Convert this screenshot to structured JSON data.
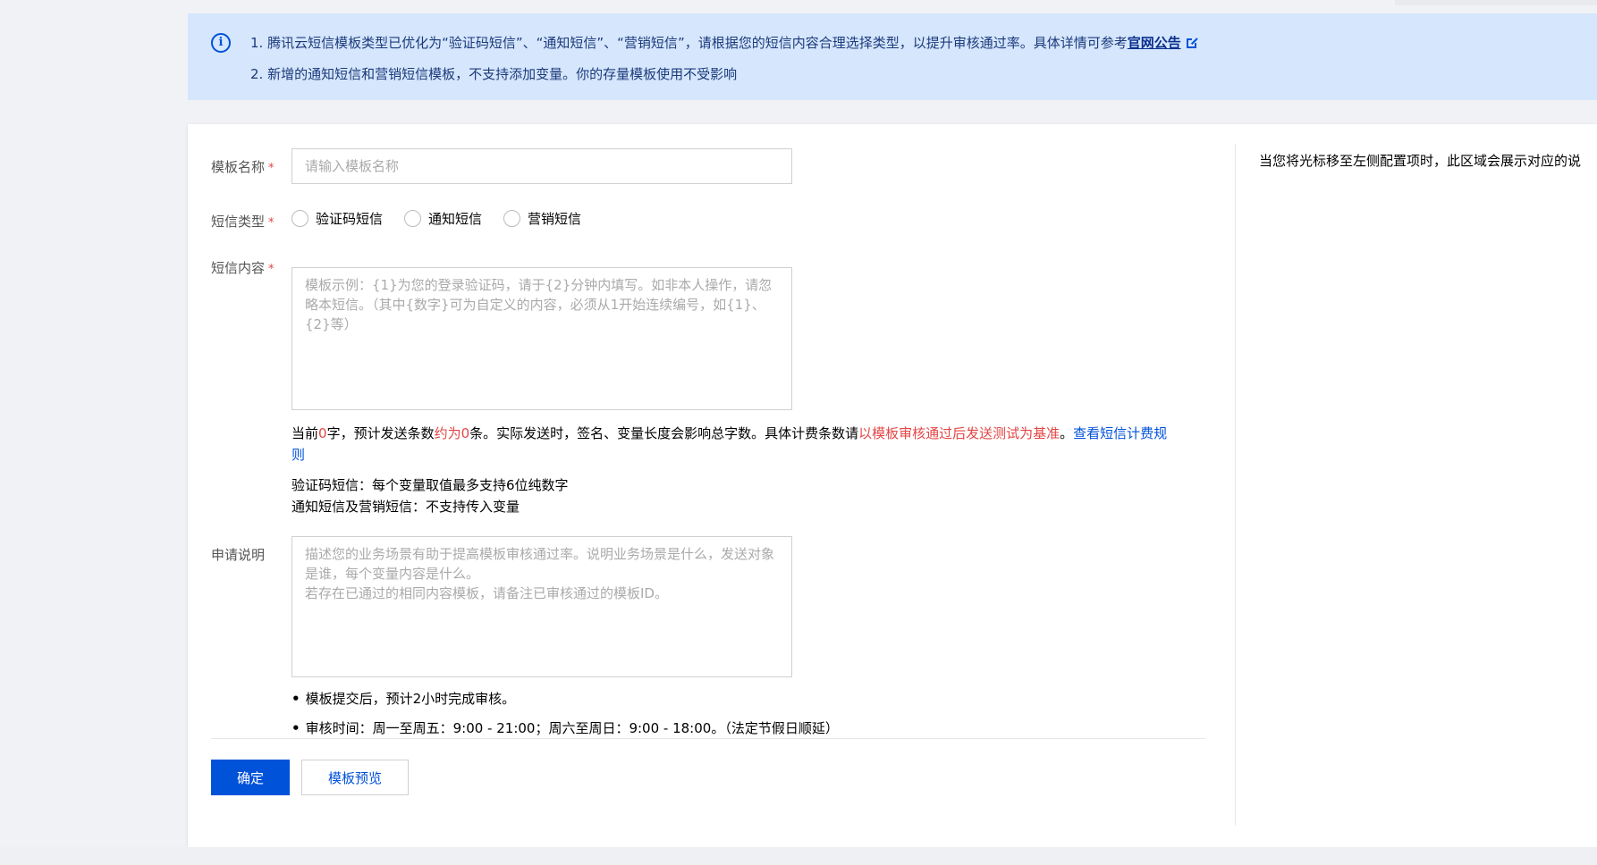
{
  "notice": {
    "icon": "info-circle-icon",
    "line1_text": "1. 腾讯云短信模板类型已优化为“验证码短信”、“通知短信”、“营销短信”，请根据您的短信内容合理选择类型，以提升审核通过率。具体详情可参考",
    "line1_link": "官网公告",
    "line2_text": "2. 新增的通知短信和营销短信模板，不支持添加变量。你的存量模板使用不受影响"
  },
  "form": {
    "name": {
      "label": "模板名称",
      "required": "*",
      "placeholder": "请输入模板名称"
    },
    "type": {
      "label": "短信类型",
      "required": "*",
      "options": [
        "验证码短信",
        "通知短信",
        "营销短信"
      ]
    },
    "content": {
      "label": "短信内容",
      "required": "*",
      "placeholder": "模板示例：{1}为您的登录验证码，请于{2}分钟内填写。如非本人操作，请忽略本短信。（其中{数字}可为自定义的内容，必须从1开始连续编号，如{1}、{2}等）",
      "count_prefix": "当前",
      "count_value": "0",
      "count_mid": "字，预计发送条数",
      "count_estimate": "约为0",
      "count_suffix": "条。实际发送时，签名、变量长度会影响总字数。具体计费条数请",
      "count_note": "以模板审核通过后发送测试为基准",
      "count_end": "。",
      "billing_link": "查看短信计费规则",
      "limit_line1": "验证码短信：每个变量取值最多支持6位纯数字",
      "limit_line2": "通知短信及营销短信：不支持传入变量"
    },
    "apply": {
      "label": "申请说明",
      "placeholder": "描述您的业务场景有助于提高模板审核通过率。说明业务场景是什么，发送对象是谁，每个变量内容是什么。\n若存在已通过的相同内容模板，请备注已审核通过的模板ID。"
    },
    "bullets": [
      "模板提交后，预计2小时完成审核。",
      "审核时间：周一至周五：9:00 - 21:00；周六至周日：9:00 - 18:00。（法定节假日顺延）"
    ],
    "confirm_label": "确定",
    "preview_label": "模板预览"
  },
  "side_hint": "当您将光标移至左侧配置项时，此区域会展示对应的说",
  "colors": {
    "primary": "#0052d9",
    "notice_bg": "#d5e6fd",
    "required": "#e54545"
  }
}
